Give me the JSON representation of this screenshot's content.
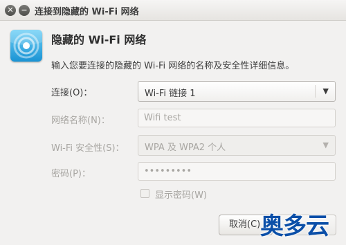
{
  "window": {
    "title": "连接到隐藏的 Wi-Fi 网络",
    "close_glyph": "✕",
    "minimize_glyph": "−"
  },
  "dialog": {
    "icon": "wifi-icon",
    "title": "隐藏的 Wi-Fi 网络",
    "description": "输入您要连接的隐藏的 Wi-Fi 网络的名称及安全性详细信息。"
  },
  "form": {
    "connection": {
      "label": "连接(O)：",
      "value": "Wi-Fi 链接 1",
      "enabled": true
    },
    "network_name": {
      "label": "网络名称(N)：",
      "value": "Wifi test",
      "enabled": false
    },
    "security": {
      "label": "Wi-Fi 安全性(S)：",
      "value": "WPA 及 WPA2 个人",
      "enabled": false
    },
    "password": {
      "label": "密码(P)：",
      "value": "•••••••••",
      "enabled": false
    },
    "show_password": {
      "label": "显示密码(W)",
      "checked": false,
      "enabled": false
    }
  },
  "buttons": {
    "cancel_label": "取消(C)"
  },
  "watermark": {
    "text": "奥多云",
    "color": "#0b4fa8"
  },
  "colors": {
    "accent": "#1a93d4",
    "window_bg": "#f2f1f0"
  }
}
